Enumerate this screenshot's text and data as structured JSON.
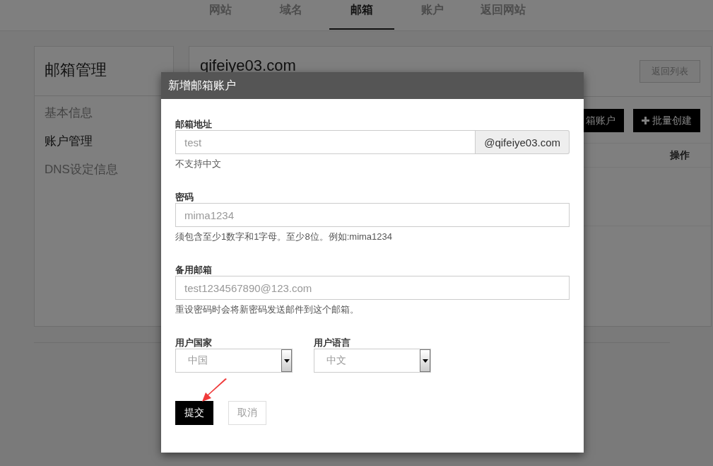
{
  "top_nav": {
    "tabs": [
      {
        "label": "网站",
        "selected": false
      },
      {
        "label": "域名",
        "selected": false
      },
      {
        "label": "邮箱",
        "selected": true
      },
      {
        "label": "账户",
        "selected": false
      },
      {
        "label": "返回网站",
        "selected": false
      }
    ]
  },
  "sidebar": {
    "title": "邮箱管理",
    "items": [
      {
        "label": "基本信息",
        "selected": false
      },
      {
        "label": "账户管理",
        "selected": true
      },
      {
        "label": "DNS设定信息",
        "selected": false
      }
    ]
  },
  "main": {
    "domain": "qifeiye03.com",
    "back_button": "返回列表",
    "actions": [
      {
        "label": "箱账户",
        "kind": "plain"
      },
      {
        "label": "批量创建",
        "kind": "add"
      }
    ],
    "table": {
      "columns": [
        {
          "label": "操作"
        }
      ]
    }
  },
  "dialog": {
    "title": "新增邮箱账户",
    "fields": [
      {
        "label": "邮箱地址",
        "placeholder": "test",
        "addon": "@qifeiye03.com",
        "hint": "不支持中文"
      },
      {
        "label": "密码",
        "placeholder": "mima1234",
        "hint": "须包含至少1数字和1字母。至少8位。例如:mima1234"
      },
      {
        "label": "备用邮箱",
        "placeholder": "test1234567890@123.com",
        "hint": "重设密码时会将新密码发送邮件到这个邮箱。"
      }
    ],
    "selects": [
      {
        "label": "用户国家",
        "value": "中国"
      },
      {
        "label": "用户语言",
        "value": "中文"
      }
    ],
    "buttons": [
      {
        "label": "提交",
        "kind": "primary"
      },
      {
        "label": "取消",
        "kind": "secondary"
      }
    ]
  }
}
